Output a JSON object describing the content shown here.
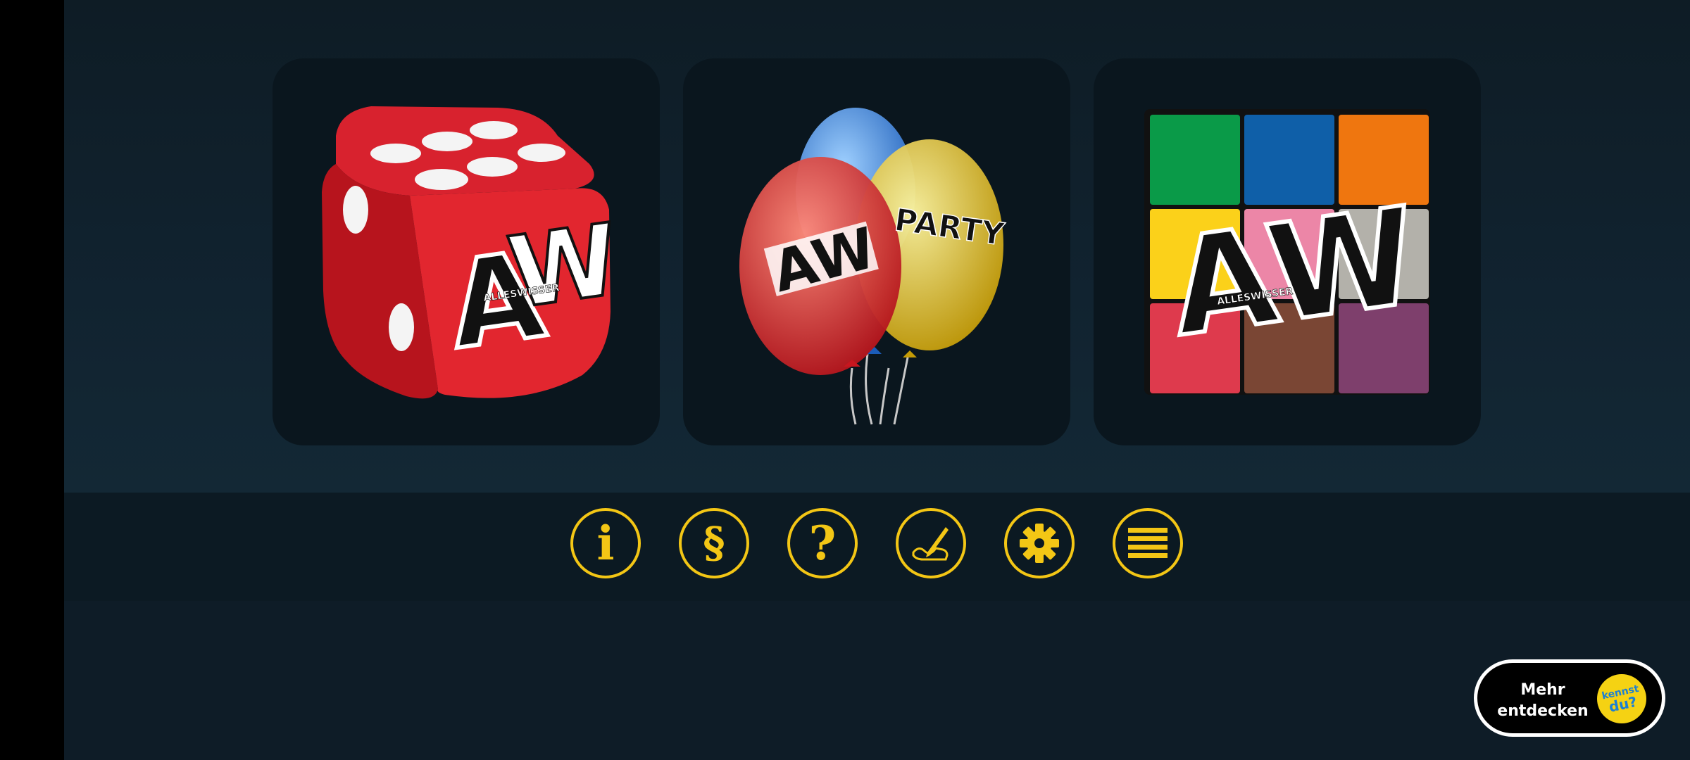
{
  "tiles": [
    {
      "id": "dice",
      "logo": "AW",
      "brand": "ALLESWISSER"
    },
    {
      "id": "party",
      "logo": "AW",
      "brand": "ALLESWISSER",
      "word": "PARTY"
    },
    {
      "id": "colors",
      "logo": "AW",
      "brand": "ALLESWISSER"
    }
  ],
  "toolbar": {
    "info_glyph": "i",
    "paragraph_glyph": "§",
    "help_glyph": "?",
    "icons": [
      "info-icon",
      "paragraph-icon",
      "help-icon",
      "signature-icon",
      "gear-icon",
      "menu-icon"
    ],
    "color": "#f3c615"
  },
  "more_button": {
    "label": "Mehr\nentdecken",
    "badge_text": "kennst du?"
  },
  "colors": {
    "grid": [
      "#0a9a48",
      "#0f5fa8",
      "#ef760f",
      "#fbd11a",
      "#ec86a7",
      "#b3b1aa",
      "#de3a4d",
      "#7a4634",
      "#7e3f6c"
    ]
  }
}
